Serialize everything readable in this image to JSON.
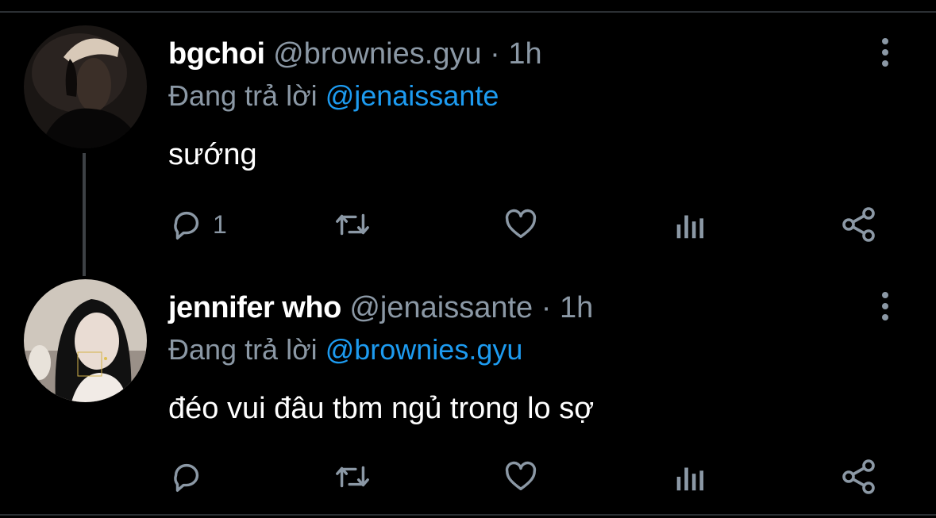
{
  "colors": {
    "background": "#000000",
    "text": "#ffffff",
    "secondary": "#8b98a5",
    "accent": "#1d9bf0"
  },
  "tweets": [
    {
      "name": "bgchoi",
      "handle": "@brownies.gyu",
      "separator": "·",
      "time": "1h",
      "reply_prefix": "Đang trả lời",
      "reply_to": "@jenaissante",
      "text": "sướng",
      "reply_count": "1",
      "icons": [
        "reply-icon",
        "retweet-icon",
        "like-icon",
        "views-icon",
        "share-icon",
        "more-icon"
      ]
    },
    {
      "name": "jennifer who",
      "handle": "@jenaissante",
      "separator": "·",
      "time": "1h",
      "reply_prefix": "Đang trả lời",
      "reply_to": "@brownies.gyu",
      "text": "đéo vui đâu tbm ngủ trong lo sợ",
      "reply_count": "",
      "icons": [
        "reply-icon",
        "retweet-icon",
        "like-icon",
        "views-icon",
        "share-icon",
        "more-icon"
      ]
    }
  ]
}
